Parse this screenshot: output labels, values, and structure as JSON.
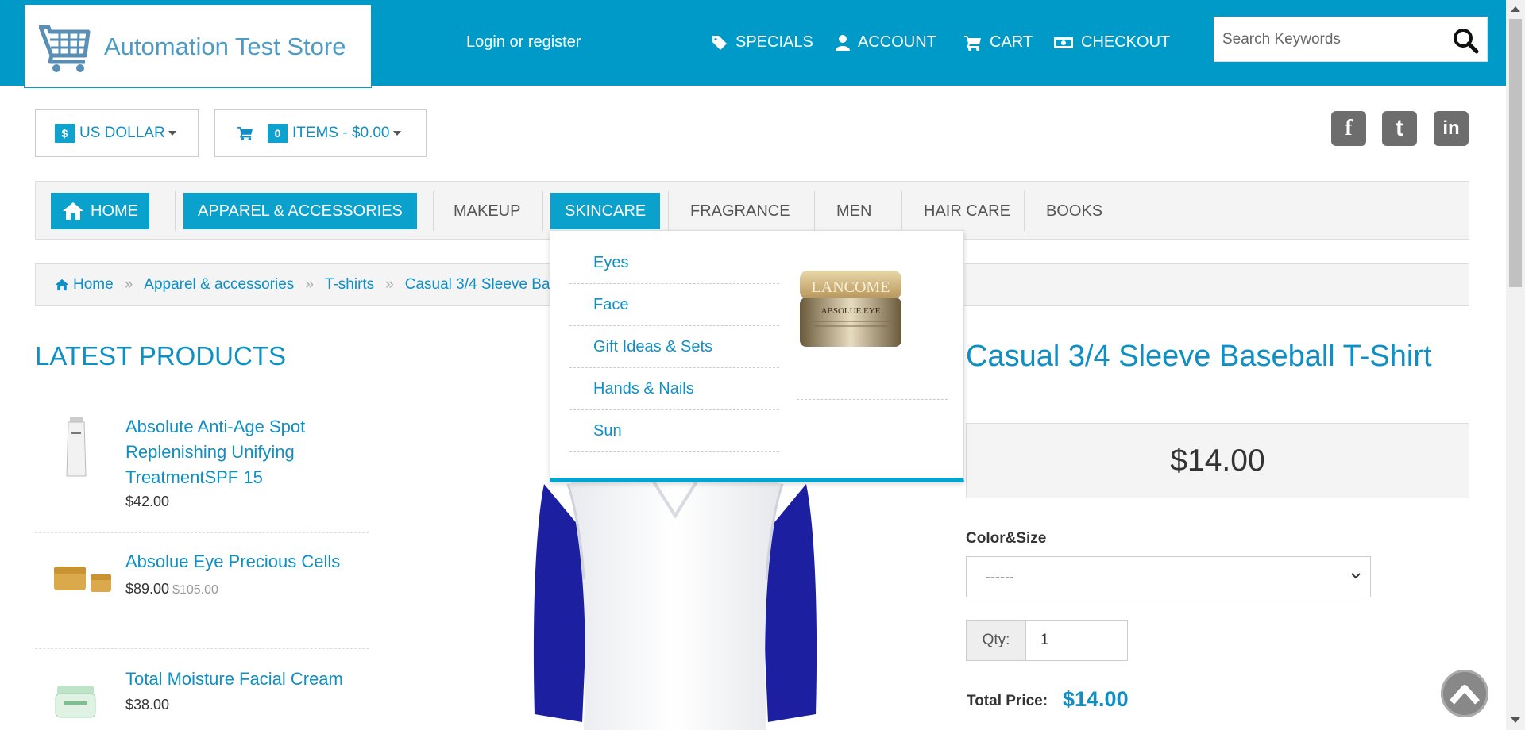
{
  "header": {
    "store_name": "Automation Test Store",
    "login_label": "Login or register",
    "nav": {
      "specials": "Specials",
      "account": "Account",
      "cart": "Cart",
      "checkout": "Checkout"
    },
    "search_placeholder": "Search Keywords"
  },
  "currency": {
    "symbol": "$",
    "label": "US DOLLAR"
  },
  "cart_summary": {
    "count": "0",
    "label": "ITEMS - $0.00"
  },
  "social": {
    "facebook": "f",
    "twitter": "t",
    "linkedin": "in"
  },
  "main_nav": {
    "home": "Home",
    "apparel": "Apparel & accessories",
    "makeup": "Makeup",
    "skincare": "Skincare",
    "fragrance": "Fragrance",
    "men": "Men",
    "hair_care": "Hair Care",
    "books": "Books"
  },
  "breadcrumb": {
    "home": "Home",
    "apparel": "Apparel & accessories",
    "tshirts": "T-shirts",
    "current": "Casual 3/4 Sleeve Baseball T-Shirt"
  },
  "latest": {
    "title": "Latest Products",
    "items": [
      {
        "name": "Absolute Anti-Age Spot Replenishing Unifying TreatmentSPF 15",
        "price": "$42.00"
      },
      {
        "name": "Absolue Eye Precious Cells",
        "price": "$89.00",
        "old_price": "$105.00"
      },
      {
        "name": "Total Moisture Facial Cream",
        "price": "$38.00"
      }
    ]
  },
  "skincare_menu": {
    "items": [
      "Eyes",
      "Face",
      "Gift Ideas & Sets",
      "Hands & Nails",
      "Sun"
    ],
    "image_brand": "LANCOME",
    "image_product": "ABSOLUE EYE"
  },
  "product": {
    "title": "Casual 3/4 Sleeve Baseball T-Shirt",
    "price": "$14.00",
    "option_label": "Color&Size",
    "option_value": "------",
    "qty_label": "Qty:",
    "qty_value": "1",
    "total_label": "Total Price:",
    "total_value": "$14.00"
  },
  "colors": {
    "brand_blue": "#009ac9",
    "link_blue": "#0f8fc4",
    "sleeve_navy": "#1c1fa0"
  }
}
